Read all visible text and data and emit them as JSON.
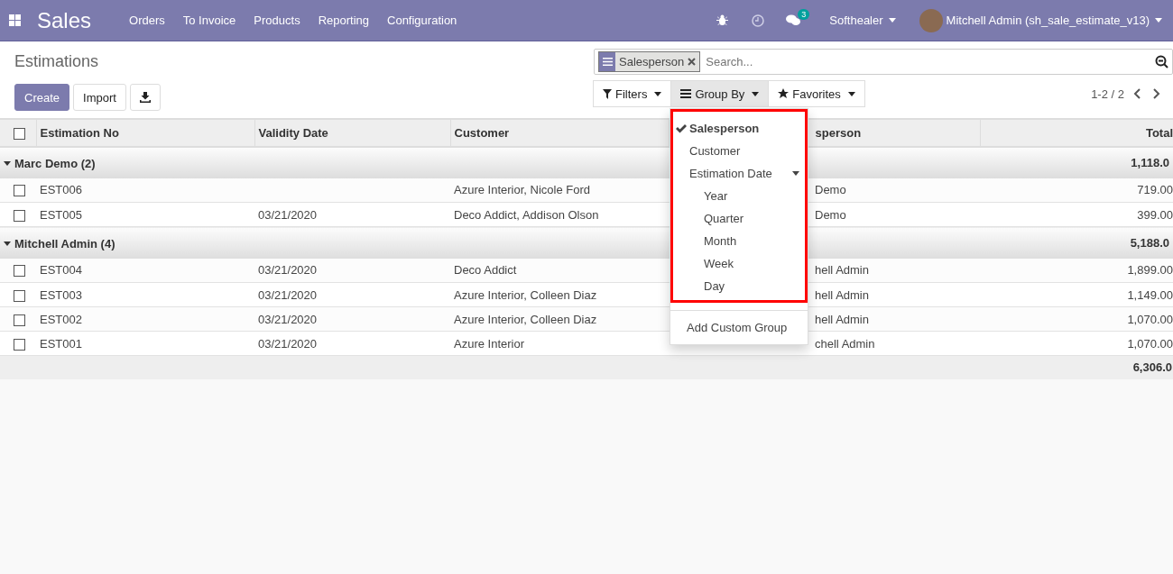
{
  "navbar": {
    "app_title": "Sales",
    "menu": [
      "Orders",
      "To Invoice",
      "Products",
      "Reporting",
      "Configuration"
    ],
    "messages_badge": "3",
    "company": "Softhealer",
    "user": "Mitchell Admin (sh_sale_estimate_v13)"
  },
  "breadcrumb": "Estimations",
  "buttons": {
    "create": "Create",
    "import": "Import"
  },
  "search": {
    "facet": "Salesperson",
    "placeholder": "Search..."
  },
  "search_tabs": [
    {
      "label": "Filters",
      "kind": "filter",
      "selected": false
    },
    {
      "label": "Group By",
      "kind": "group",
      "selected": true
    },
    {
      "label": "Favorites",
      "kind": "star",
      "selected": false
    }
  ],
  "pager": "1-2 / 2",
  "table": {
    "all_checked": false,
    "columns": [
      "Estimation No",
      "Validity Date",
      "Customer",
      "sperson",
      "Total"
    ],
    "groups": [
      {
        "name": "Marc Demo (2)",
        "expanded": true,
        "total": "1,118.0",
        "rows": [
          {
            "checked": false,
            "cells": [
              "EST006",
              "",
              "Azure Interior, Nicole Ford",
              "Demo",
              "719.00"
            ]
          },
          {
            "checked": false,
            "cells": [
              "EST005",
              "03/21/2020",
              "Deco Addict, Addison Olson",
              "Demo",
              "399.00"
            ]
          }
        ]
      },
      {
        "name": "Mitchell Admin (4)",
        "expanded": true,
        "total": "5,188.0",
        "rows": [
          {
            "checked": false,
            "cells": [
              "EST004",
              "03/21/2020",
              "Deco Addict",
              "hell Admin",
              "1,899.00"
            ]
          },
          {
            "checked": false,
            "cells": [
              "EST003",
              "03/21/2020",
              "Azure Interior, Colleen Diaz",
              "hell Admin",
              "1,149.00"
            ]
          },
          {
            "checked": false,
            "cells": [
              "EST002",
              "03/21/2020",
              "Azure Interior, Colleen Diaz",
              "hell Admin",
              "1,070.00"
            ]
          },
          {
            "checked": false,
            "cells": [
              "EST001",
              "03/21/2020",
              "Azure Interior",
              "chell Admin",
              "1,070.00"
            ]
          }
        ]
      }
    ],
    "grand_total": "6,306.0"
  },
  "group_by_menu": {
    "options": [
      {
        "label": "Salesperson",
        "checked": true,
        "kind": "option"
      },
      {
        "label": "Customer",
        "checked": false,
        "kind": "option"
      },
      {
        "label": "Estimation Date",
        "checked": false,
        "kind": "date",
        "expanded": true,
        "children": [
          {
            "label": "Year",
            "checked": false
          },
          {
            "label": "Quarter",
            "checked": false
          },
          {
            "label": "Month",
            "checked": false
          },
          {
            "label": "Week",
            "checked": false
          },
          {
            "label": "Day",
            "checked": false
          }
        ]
      }
    ],
    "custom": "Add Custom Group"
  }
}
